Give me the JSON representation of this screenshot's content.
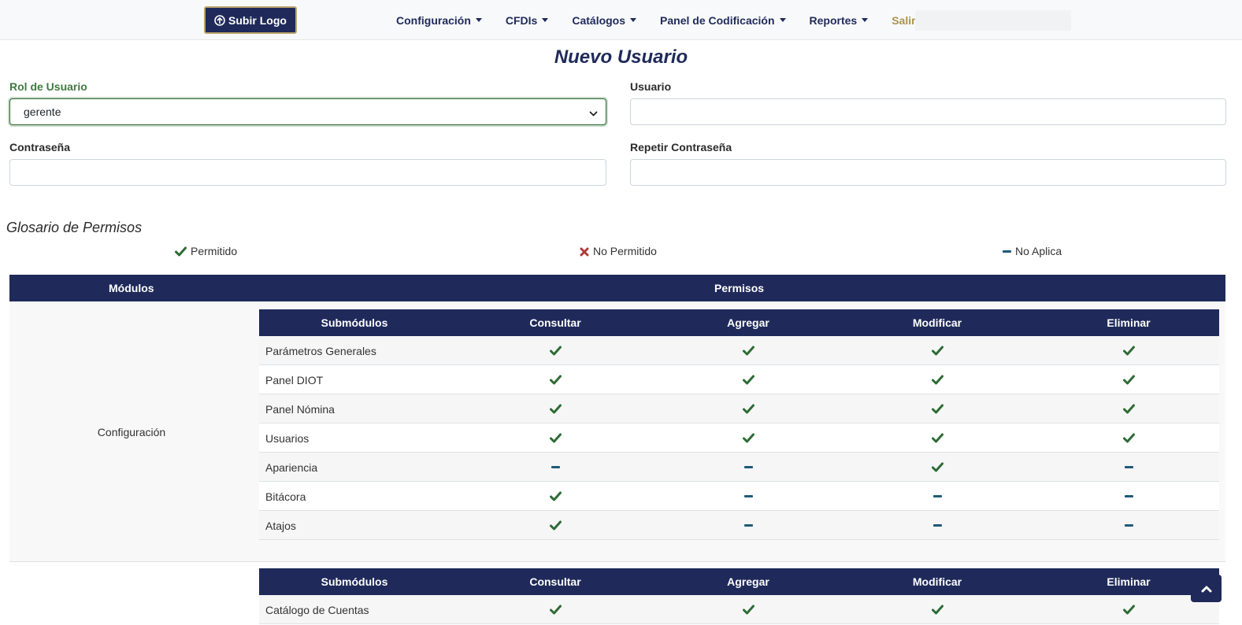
{
  "navbar": {
    "logo_button": "Subir Logo",
    "menu": [
      {
        "label": "Configuración"
      },
      {
        "label": "CFDIs"
      },
      {
        "label": "Catálogos"
      },
      {
        "label": "Panel de Codificación"
      },
      {
        "label": "Reportes"
      }
    ],
    "exit_label": "Salir"
  },
  "page": {
    "title": "Nuevo Usuario"
  },
  "form": {
    "role": {
      "label": "Rol de Usuario",
      "value": "gerente"
    },
    "user": {
      "label": "Usuario",
      "value": ""
    },
    "password": {
      "label": "Contraseña",
      "value": ""
    },
    "repeat_password": {
      "label": "Repetir Contraseña",
      "value": ""
    }
  },
  "glossary": {
    "title": "Glosario de Permisos",
    "allowed": "Permitido",
    "not_allowed": "No Permitido",
    "not_applicable": "No Aplica"
  },
  "permissions": {
    "header_modules": "Módulos",
    "header_permissions": "Permisos",
    "sub_columns": [
      "Submódulos",
      "Consultar",
      "Agregar",
      "Modificar",
      "Eliminar"
    ],
    "modules": [
      {
        "name": "Configuración",
        "submodules": [
          {
            "name": "Parámetros Generales",
            "perms": [
              "allowed",
              "allowed",
              "allowed",
              "allowed"
            ]
          },
          {
            "name": "Panel DIOT",
            "perms": [
              "allowed",
              "allowed",
              "allowed",
              "allowed"
            ]
          },
          {
            "name": "Panel Nómina",
            "perms": [
              "allowed",
              "allowed",
              "allowed",
              "allowed"
            ]
          },
          {
            "name": "Usuarios",
            "perms": [
              "allowed",
              "allowed",
              "allowed",
              "allowed"
            ]
          },
          {
            "name": "Apariencia",
            "perms": [
              "na",
              "na",
              "allowed",
              "na"
            ]
          },
          {
            "name": "Bitácora",
            "perms": [
              "allowed",
              "na",
              "na",
              "na"
            ]
          },
          {
            "name": "Atajos",
            "perms": [
              "allowed",
              "na",
              "na",
              "na"
            ]
          }
        ]
      },
      {
        "name": "",
        "submodules": [
          {
            "name": "Catálogo de Cuentas",
            "perms": [
              "allowed",
              "allowed",
              "allowed",
              "allowed"
            ]
          }
        ]
      }
    ]
  },
  "colors": {
    "navy": "#1f2a5a",
    "check_green": "#2e6b35",
    "x_red": "#b03a3a",
    "na_blue": "#1f5a78",
    "exit_gold": "#a8944f"
  }
}
